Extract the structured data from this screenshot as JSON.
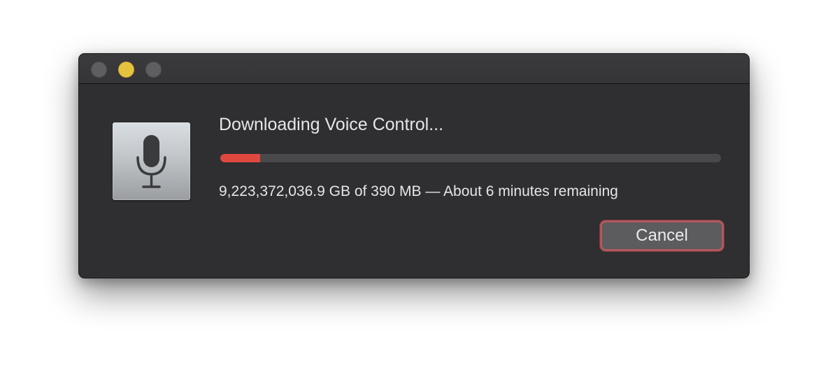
{
  "dialog": {
    "title": "Downloading Voice Control...",
    "status": "9,223,372,036.9 GB of 390 MB — About 6 minutes remaining",
    "progress_fraction": 0.08,
    "cancel_label": "Cancel"
  },
  "window_controls": {
    "close": "close-button",
    "minimize": "minimize-button",
    "zoom": "zoom-button"
  },
  "icons": {
    "app": "microphone-icon"
  },
  "colors": {
    "window_background": "#2f2e31",
    "progress_fill": "#e0483f",
    "progress_track": "#49484b",
    "minimize_button": "#e6c33e",
    "focus_ring": "#b0585d"
  }
}
